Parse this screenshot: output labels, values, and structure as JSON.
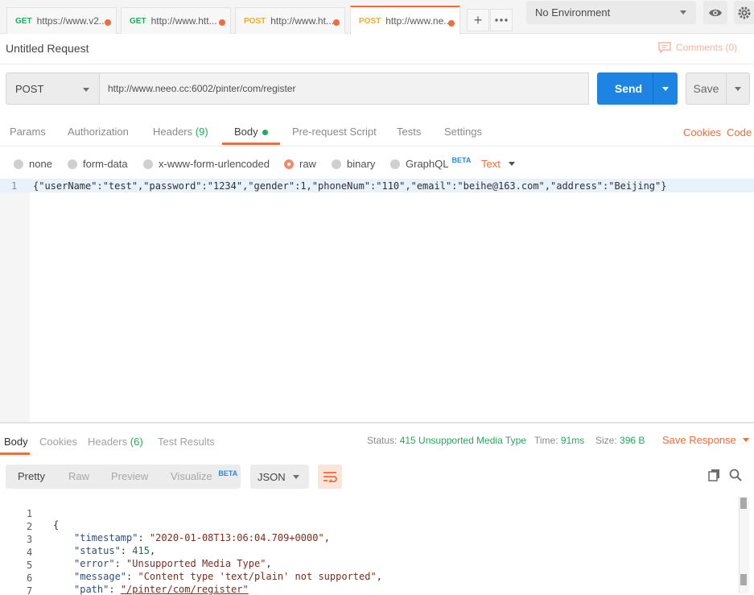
{
  "tabs": [
    {
      "method": "GET",
      "url": "https://www.v2...",
      "active": false
    },
    {
      "method": "GET",
      "url": "http://www.htt...",
      "active": false
    },
    {
      "method": "POST",
      "url": "http://www.ht...",
      "active": false
    },
    {
      "method": "POST",
      "url": "http://www.ne...",
      "active": true
    }
  ],
  "environment": {
    "selected": "No Environment"
  },
  "request": {
    "title": "Untitled Request",
    "comments_label": "Comments (0)",
    "method": "POST",
    "url": "http://www.neeo.cc:6002/pinter/com/register",
    "send_label": "Send",
    "save_label": "Save"
  },
  "request_tabs": {
    "params": "Params",
    "authorization": "Authorization",
    "headers": "Headers",
    "headers_count": "(9)",
    "body": "Body",
    "prerequest": "Pre-request Script",
    "tests": "Tests",
    "settings": "Settings",
    "cookies": "Cookies",
    "code": "Code"
  },
  "body_types": {
    "none": "none",
    "form_data": "form-data",
    "urlencoded": "x-www-form-urlencoded",
    "raw": "raw",
    "binary": "binary",
    "graphql": "GraphQL",
    "beta": "BETA",
    "format": "Text",
    "selected": "raw"
  },
  "request_body": {
    "line_number": "1",
    "code": "{\"userName\":\"test\",\"password\":\"1234\",\"gender\":1,\"phoneNum\":\"110\",\"email\":\"beihe@163.com\",\"address\":\"Beijing\"}"
  },
  "response": {
    "tabs": {
      "body": "Body",
      "cookies": "Cookies",
      "headers": "Headers",
      "headers_count": "(6)",
      "test_results": "Test Results"
    },
    "status_label": "Status:",
    "status_value": "415 Unsupported Media Type",
    "time_label": "Time:",
    "time_value": "91ms",
    "size_label": "Size:",
    "size_value": "396 B",
    "save_response": "Save Response",
    "views": {
      "pretty": "Pretty",
      "raw": "Raw",
      "preview": "Preview",
      "visualize": "Visualize",
      "beta": "BETA"
    },
    "format": "JSON",
    "lines": [
      {
        "n": "1",
        "open": "{"
      },
      {
        "n": "2",
        "key": "\"timestamp\"",
        "value": "\"2020-01-08T13:06:04.709+0000\"",
        "tail": ","
      },
      {
        "n": "3",
        "key": "\"status\"",
        "value": "415",
        "tail": ","
      },
      {
        "n": "4",
        "key": "\"error\"",
        "value": "\"Unsupported Media Type\"",
        "tail": ","
      },
      {
        "n": "5",
        "key": "\"message\"",
        "value": "\"Content type 'text/plain' not supported\"",
        "tail": ","
      },
      {
        "n": "6",
        "key": "\"path\"",
        "value": "\"/pinter/com/register\"",
        "tail": ""
      },
      {
        "n": "7",
        "open": "}"
      }
    ]
  }
}
